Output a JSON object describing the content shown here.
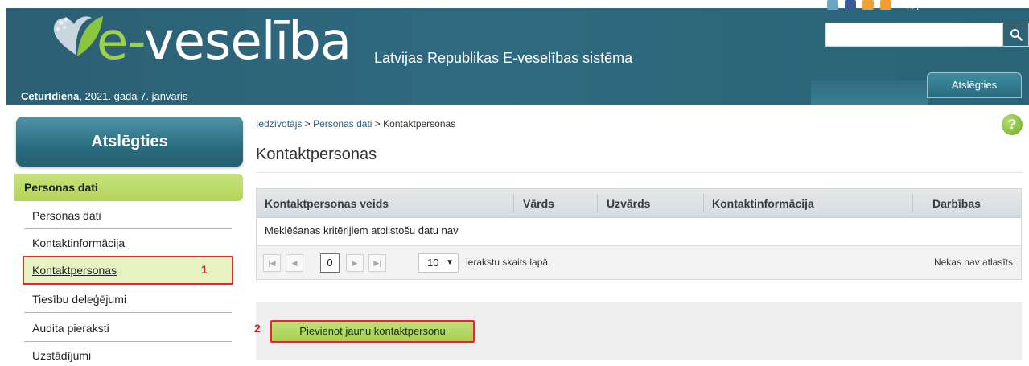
{
  "header": {
    "logo_e": "e-",
    "logo_rest": "veselība",
    "tagline": "Latvijas Republikas E-veselības sistēma",
    "date_day": "Ceturtdiena",
    "date_rest": ", 2021. gada 7. janvāris",
    "top_link": "Vieglā valoda",
    "search_placeholder": "",
    "logout_label": "Atslēgties",
    "brand_green": "#9ed24a",
    "brand_teal": "#2c5f73"
  },
  "sidebar": {
    "logout_label": "Atslēgties",
    "section_label": "Personas dati",
    "items": [
      {
        "label": "Personas dati"
      },
      {
        "label": "Kontaktinformācija"
      },
      {
        "label": "Kontaktpersonas"
      },
      {
        "label": "Tiesību deleģējumi"
      },
      {
        "label": "Audita pieraksti"
      },
      {
        "label": "Uzstādījumi"
      }
    ],
    "marker": "1"
  },
  "main": {
    "breadcrumb": [
      "Iedzīvotājs",
      "Personas dati",
      "Kontaktpersonas"
    ],
    "breadcrumb_sep": " > ",
    "help": "?",
    "title": "Kontaktpersonas",
    "table": {
      "columns": [
        "Kontaktpersonas veids",
        "Vārds",
        "Uzvārds",
        "Kontaktinformācija",
        "Darbības"
      ],
      "empty_message": "Meklēšanas kritērijiem atbilstošu datu nav"
    },
    "pager": {
      "page": "0",
      "page_size": "10",
      "page_size_label": "ierakstu skaits lapā",
      "status": "Nekas nav atlasīts"
    },
    "add_button": "Pievienot jaunu kontaktpersonu",
    "marker": "2"
  }
}
